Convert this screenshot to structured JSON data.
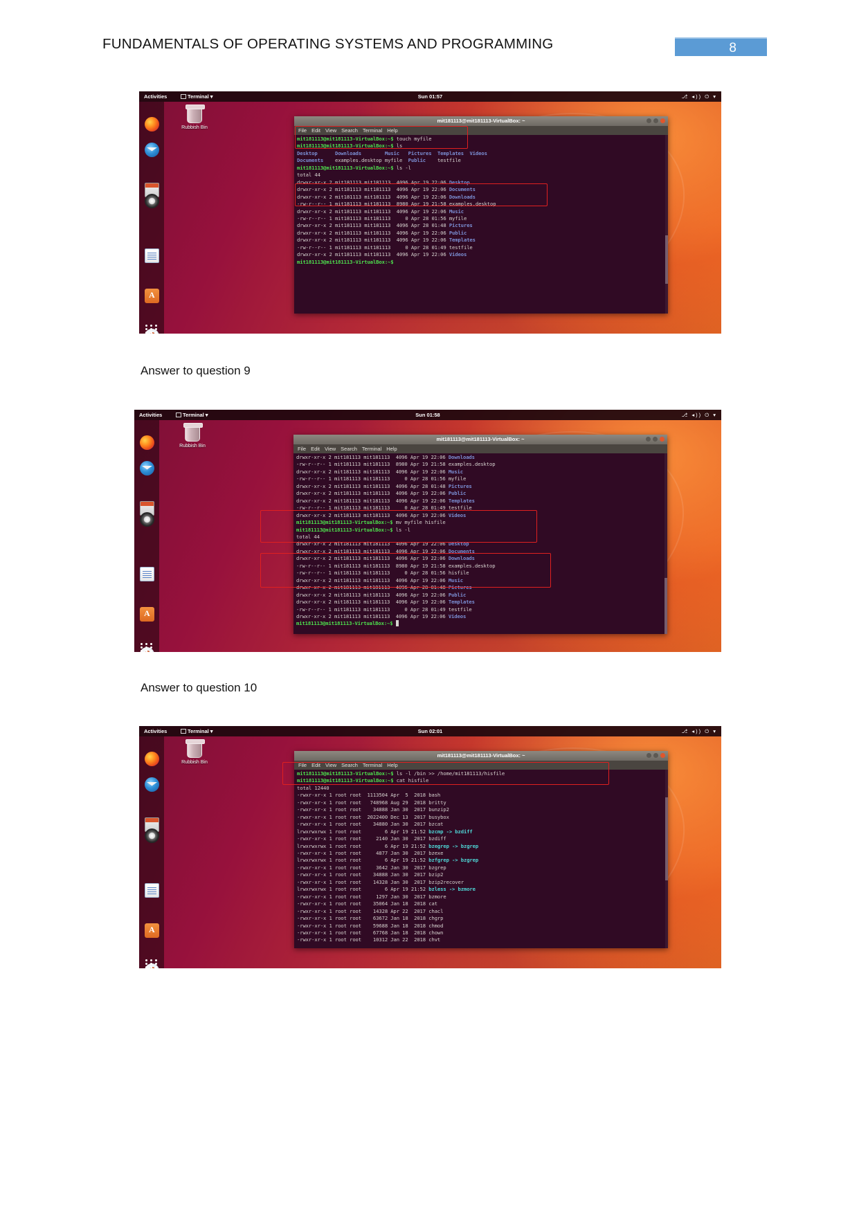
{
  "document": {
    "header_title": "FUNDAMENTALS OF OPERATING SYSTEMS AND PROGRAMMING",
    "page_number": "8",
    "accent_color": "#5b9bd5"
  },
  "captions": {
    "answer9": "Answer to question 9",
    "answer10": "Answer to question 10"
  },
  "desktop": {
    "activities": "Activities",
    "app_menu": "Terminal",
    "app_menu_arrow": "▾",
    "tray": "⎇  ◂))  ⏻  ▾",
    "bin_label": "Rubbish Bin",
    "dock_icons": [
      "firefox-icon",
      "thunderbird-icon",
      "files-icon",
      "rhythmbox-icon",
      "libreoffice-writer-icon",
      "ubuntu-software-icon",
      "help-icon",
      "amazon-icon",
      "show-applications-icon"
    ]
  },
  "terminal_common": {
    "window_title": "mit181113@mit181113-VirtualBox: ~",
    "menu": [
      "File",
      "Edit",
      "View",
      "Search",
      "Terminal",
      "Help"
    ],
    "prompt": "mit181113@mit181113-VirtualBox:~$"
  },
  "figures": [
    {
      "id": "figure-1",
      "clock": "Sun 01:57",
      "lines": [
        {
          "t": "prompt",
          "p": "mit181113@mit181113-VirtualBox:~$",
          "c": " touch myfile"
        },
        {
          "t": "prompt",
          "p": "mit181113@mit181113-VirtualBox:~$",
          "c": " ls"
        },
        {
          "t": "cols",
          "items": [
            {
              "n": "Desktop",
              "k": "d"
            },
            {
              "n": "Downloads",
              "k": "d"
            },
            {
              "n": "Music",
              "k": "d"
            },
            {
              "n": "Pictures",
              "k": "d"
            },
            {
              "n": "Templates",
              "k": "d"
            },
            {
              "n": "Videos",
              "k": "d"
            }
          ]
        },
        {
          "t": "cols",
          "items": [
            {
              "n": "Documents",
              "k": "d"
            },
            {
              "n": "examples.desktop",
              "k": "f"
            },
            {
              "n": "myfile",
              "k": "f"
            },
            {
              "n": "Public",
              "k": "d"
            },
            {
              "n": "testfile",
              "k": "f"
            }
          ]
        },
        {
          "t": "prompt",
          "p": "mit181113@mit181113-VirtualBox:~$",
          "c": " ls -l"
        },
        {
          "t": "plain",
          "c": "total 44"
        },
        {
          "t": "ls",
          "perm": "drwxr-xr-x",
          "n": "2",
          "u": "mit181113",
          "g": "mit181113",
          "sz": "4096",
          "d": "Apr 19 22:06",
          "name": "Desktop",
          "k": "d"
        },
        {
          "t": "ls",
          "perm": "drwxr-xr-x",
          "n": "2",
          "u": "mit181113",
          "g": "mit181113",
          "sz": "4096",
          "d": "Apr 19 22:06",
          "name": "Documents",
          "k": "d"
        },
        {
          "t": "ls",
          "perm": "drwxr-xr-x",
          "n": "2",
          "u": "mit181113",
          "g": "mit181113",
          "sz": "4096",
          "d": "Apr 19 22:06",
          "name": "Downloads",
          "k": "d"
        },
        {
          "t": "ls",
          "perm": "-rw-r--r--",
          "n": "1",
          "u": "mit181113",
          "g": "mit181113",
          "sz": "8980",
          "d": "Apr 19 21:58",
          "name": "examples.desktop",
          "k": "f"
        },
        {
          "t": "ls",
          "perm": "drwxr-xr-x",
          "n": "2",
          "u": "mit181113",
          "g": "mit181113",
          "sz": "4096",
          "d": "Apr 19 22:06",
          "name": "Music",
          "k": "d"
        },
        {
          "t": "ls",
          "perm": "-rw-r--r--",
          "n": "1",
          "u": "mit181113",
          "g": "mit181113",
          "sz": "0",
          "d": "Apr 28 01:56",
          "name": "myfile",
          "k": "f"
        },
        {
          "t": "ls",
          "perm": "drwxr-xr-x",
          "n": "2",
          "u": "mit181113",
          "g": "mit181113",
          "sz": "4096",
          "d": "Apr 28 01:48",
          "name": "Pictures",
          "k": "d"
        },
        {
          "t": "ls",
          "perm": "drwxr-xr-x",
          "n": "2",
          "u": "mit181113",
          "g": "mit181113",
          "sz": "4096",
          "d": "Apr 19 22:06",
          "name": "Public",
          "k": "d"
        },
        {
          "t": "ls",
          "perm": "drwxr-xr-x",
          "n": "2",
          "u": "mit181113",
          "g": "mit181113",
          "sz": "4096",
          "d": "Apr 19 22:06",
          "name": "Templates",
          "k": "d"
        },
        {
          "t": "ls",
          "perm": "-rw-r--r--",
          "n": "1",
          "u": "mit181113",
          "g": "mit181113",
          "sz": "0",
          "d": "Apr 28 01:49",
          "name": "testfile",
          "k": "f"
        },
        {
          "t": "ls",
          "perm": "drwxr-xr-x",
          "n": "2",
          "u": "mit181113",
          "g": "mit181113",
          "sz": "4096",
          "d": "Apr 19 22:06",
          "name": "Videos",
          "k": "d"
        },
        {
          "t": "prompt",
          "p": "mit181113@mit181113-VirtualBox:~$",
          "c": ""
        }
      ]
    },
    {
      "id": "figure-2",
      "clock": "Sun 01:58",
      "lines": [
        {
          "t": "ls",
          "perm": "drwxr-xr-x",
          "n": "2",
          "u": "mit181113",
          "g": "mit181113",
          "sz": "4096",
          "d": "Apr 19 22:06",
          "name": "Downloads",
          "k": "d"
        },
        {
          "t": "ls",
          "perm": "-rw-r--r--",
          "n": "1",
          "u": "mit181113",
          "g": "mit181113",
          "sz": "8980",
          "d": "Apr 19 21:58",
          "name": "examples.desktop",
          "k": "f"
        },
        {
          "t": "ls",
          "perm": "drwxr-xr-x",
          "n": "2",
          "u": "mit181113",
          "g": "mit181113",
          "sz": "4096",
          "d": "Apr 19 22:06",
          "name": "Music",
          "k": "d"
        },
        {
          "t": "ls",
          "perm": "-rw-r--r--",
          "n": "1",
          "u": "mit181113",
          "g": "mit181113",
          "sz": "0",
          "d": "Apr 28 01:56",
          "name": "myfile",
          "k": "f"
        },
        {
          "t": "ls",
          "perm": "drwxr-xr-x",
          "n": "2",
          "u": "mit181113",
          "g": "mit181113",
          "sz": "4096",
          "d": "Apr 28 01:48",
          "name": "Pictures",
          "k": "d"
        },
        {
          "t": "ls",
          "perm": "drwxr-xr-x",
          "n": "2",
          "u": "mit181113",
          "g": "mit181113",
          "sz": "4096",
          "d": "Apr 19 22:06",
          "name": "Public",
          "k": "d"
        },
        {
          "t": "ls",
          "perm": "drwxr-xr-x",
          "n": "2",
          "u": "mit181113",
          "g": "mit181113",
          "sz": "4096",
          "d": "Apr 19 22:06",
          "name": "Templates",
          "k": "d"
        },
        {
          "t": "ls",
          "perm": "-rw-r--r--",
          "n": "1",
          "u": "mit181113",
          "g": "mit181113",
          "sz": "0",
          "d": "Apr 28 01:49",
          "name": "testfile",
          "k": "f"
        },
        {
          "t": "ls",
          "perm": "drwxr-xr-x",
          "n": "2",
          "u": "mit181113",
          "g": "mit181113",
          "sz": "4096",
          "d": "Apr 19 22:06",
          "name": "Videos",
          "k": "d"
        },
        {
          "t": "prompt",
          "p": "mit181113@mit181113-VirtualBox:~$",
          "c": " mv myfile hisfile"
        },
        {
          "t": "prompt",
          "p": "mit181113@mit181113-VirtualBox:~$",
          "c": " ls -l"
        },
        {
          "t": "plain",
          "c": "total 44"
        },
        {
          "t": "ls",
          "perm": "drwxr-xr-x",
          "n": "2",
          "u": "mit181113",
          "g": "mit181113",
          "sz": "4096",
          "d": "Apr 19 22:06",
          "name": "Desktop",
          "k": "d"
        },
        {
          "t": "ls",
          "perm": "drwxr-xr-x",
          "n": "2",
          "u": "mit181113",
          "g": "mit181113",
          "sz": "4096",
          "d": "Apr 19 22:06",
          "name": "Documents",
          "k": "d"
        },
        {
          "t": "ls",
          "perm": "drwxr-xr-x",
          "n": "2",
          "u": "mit181113",
          "g": "mit181113",
          "sz": "4096",
          "d": "Apr 19 22:06",
          "name": "Downloads",
          "k": "d"
        },
        {
          "t": "ls",
          "perm": "-rw-r--r--",
          "n": "1",
          "u": "mit181113",
          "g": "mit181113",
          "sz": "8980",
          "d": "Apr 19 21:58",
          "name": "examples.desktop",
          "k": "f"
        },
        {
          "t": "ls",
          "perm": "-rw-r--r--",
          "n": "1",
          "u": "mit181113",
          "g": "mit181113",
          "sz": "0",
          "d": "Apr 28 01:56",
          "name": "hisfile",
          "k": "f"
        },
        {
          "t": "ls",
          "perm": "drwxr-xr-x",
          "n": "2",
          "u": "mit181113",
          "g": "mit181113",
          "sz": "4096",
          "d": "Apr 19 22:06",
          "name": "Music",
          "k": "d"
        },
        {
          "t": "ls",
          "perm": "drwxr-xr-x",
          "n": "2",
          "u": "mit181113",
          "g": "mit181113",
          "sz": "4096",
          "d": "Apr 28 01:48",
          "name": "Pictures",
          "k": "d"
        },
        {
          "t": "ls",
          "perm": "drwxr-xr-x",
          "n": "2",
          "u": "mit181113",
          "g": "mit181113",
          "sz": "4096",
          "d": "Apr 19 22:06",
          "name": "Public",
          "k": "d"
        },
        {
          "t": "ls",
          "perm": "drwxr-xr-x",
          "n": "2",
          "u": "mit181113",
          "g": "mit181113",
          "sz": "4096",
          "d": "Apr 19 22:06",
          "name": "Templates",
          "k": "d"
        },
        {
          "t": "ls",
          "perm": "-rw-r--r--",
          "n": "1",
          "u": "mit181113",
          "g": "mit181113",
          "sz": "0",
          "d": "Apr 28 01:49",
          "name": "testfile",
          "k": "f"
        },
        {
          "t": "ls",
          "perm": "drwxr-xr-x",
          "n": "2",
          "u": "mit181113",
          "g": "mit181113",
          "sz": "4096",
          "d": "Apr 19 22:06",
          "name": "Videos",
          "k": "d"
        },
        {
          "t": "prompt",
          "p": "mit181113@mit181113-VirtualBox:~$",
          "c": " ",
          "cursor": true
        }
      ]
    },
    {
      "id": "figure-3",
      "clock": "Sun 02:01",
      "lines": [
        {
          "t": "prompt",
          "p": "mit181113@mit181113-VirtualBox:~$",
          "c": " ls -l /bin >> /home/mit181113/hisfile"
        },
        {
          "t": "prompt",
          "p": "mit181113@mit181113-VirtualBox:~$",
          "c": " cat hisfile"
        },
        {
          "t": "plain",
          "c": "total 12440"
        },
        {
          "t": "ls",
          "perm": "-rwxr-xr-x",
          "n": "1",
          "u": "root",
          "g": "root",
          "sz": "1113504",
          "d": "Apr  5  2018",
          "name": "bash",
          "k": "x"
        },
        {
          "t": "ls",
          "perm": "-rwxr-xr-x",
          "n": "1",
          "u": "root",
          "g": "root",
          "sz": "748968",
          "d": "Aug 29  2018",
          "name": "britty",
          "k": "x"
        },
        {
          "t": "ls",
          "perm": "-rwxr-xr-x",
          "n": "1",
          "u": "root",
          "g": "root",
          "sz": "34888",
          "d": "Jan 30  2017",
          "name": "bunzip2",
          "k": "x"
        },
        {
          "t": "ls",
          "perm": "-rwxr-xr-x",
          "n": "1",
          "u": "root",
          "g": "root",
          "sz": "2022400",
          "d": "Dec 13  2017",
          "name": "busybox",
          "k": "x"
        },
        {
          "t": "ls",
          "perm": "-rwxr-xr-x",
          "n": "1",
          "u": "root",
          "g": "root",
          "sz": "34880",
          "d": "Jan 30  2017",
          "name": "bzcat",
          "k": "x"
        },
        {
          "t": "ls",
          "perm": "lrwxrwxrwx",
          "n": "1",
          "u": "root",
          "g": "root",
          "sz": "6",
          "d": "Apr 19 21:52",
          "name": "bzcmp -> bzdiff",
          "k": "l"
        },
        {
          "t": "ls",
          "perm": "-rwxr-xr-x",
          "n": "1",
          "u": "root",
          "g": "root",
          "sz": "2140",
          "d": "Jan 30  2017",
          "name": "bzdiff",
          "k": "x"
        },
        {
          "t": "ls",
          "perm": "lrwxrwxrwx",
          "n": "1",
          "u": "root",
          "g": "root",
          "sz": "6",
          "d": "Apr 19 21:52",
          "name": "bzegrep -> bzgrep",
          "k": "l"
        },
        {
          "t": "ls",
          "perm": "-rwxr-xr-x",
          "n": "1",
          "u": "root",
          "g": "root",
          "sz": "4877",
          "d": "Jan 30  2017",
          "name": "bzexe",
          "k": "x"
        },
        {
          "t": "ls",
          "perm": "lrwxrwxrwx",
          "n": "1",
          "u": "root",
          "g": "root",
          "sz": "6",
          "d": "Apr 19 21:52",
          "name": "bzfgrep -> bzgrep",
          "k": "l"
        },
        {
          "t": "ls",
          "perm": "-rwxr-xr-x",
          "n": "1",
          "u": "root",
          "g": "root",
          "sz": "3642",
          "d": "Jan 30  2017",
          "name": "bzgrep",
          "k": "x"
        },
        {
          "t": "ls",
          "perm": "-rwxr-xr-x",
          "n": "1",
          "u": "root",
          "g": "root",
          "sz": "34888",
          "d": "Jan 30  2017",
          "name": "bzip2",
          "k": "x"
        },
        {
          "t": "ls",
          "perm": "-rwxr-xr-x",
          "n": "1",
          "u": "root",
          "g": "root",
          "sz": "14328",
          "d": "Jan 30  2017",
          "name": "bzip2recover",
          "k": "x"
        },
        {
          "t": "ls",
          "perm": "lrwxrwxrwx",
          "n": "1",
          "u": "root",
          "g": "root",
          "sz": "6",
          "d": "Apr 19 21:52",
          "name": "bzless -> bzmore",
          "k": "l"
        },
        {
          "t": "ls",
          "perm": "-rwxr-xr-x",
          "n": "1",
          "u": "root",
          "g": "root",
          "sz": "1297",
          "d": "Jan 30  2017",
          "name": "bzmore",
          "k": "x"
        },
        {
          "t": "ls",
          "perm": "-rwxr-xr-x",
          "n": "1",
          "u": "root",
          "g": "root",
          "sz": "35064",
          "d": "Jan 18  2018",
          "name": "cat",
          "k": "x"
        },
        {
          "t": "ls",
          "perm": "-rwxr-xr-x",
          "n": "1",
          "u": "root",
          "g": "root",
          "sz": "14328",
          "d": "Apr 22  2017",
          "name": "chacl",
          "k": "x"
        },
        {
          "t": "ls",
          "perm": "-rwxr-xr-x",
          "n": "1",
          "u": "root",
          "g": "root",
          "sz": "63672",
          "d": "Jan 18  2018",
          "name": "chgrp",
          "k": "x"
        },
        {
          "t": "ls",
          "perm": "-rwxr-xr-x",
          "n": "1",
          "u": "root",
          "g": "root",
          "sz": "59688",
          "d": "Jan 18  2018",
          "name": "chmod",
          "k": "x"
        },
        {
          "t": "ls",
          "perm": "-rwxr-xr-x",
          "n": "1",
          "u": "root",
          "g": "root",
          "sz": "67768",
          "d": "Jan 18  2018",
          "name": "chown",
          "k": "x"
        },
        {
          "t": "ls",
          "perm": "-rwxr-xr-x",
          "n": "1",
          "u": "root",
          "g": "root",
          "sz": "10312",
          "d": "Jan 22  2018",
          "name": "chvt",
          "k": "x"
        }
      ]
    }
  ]
}
